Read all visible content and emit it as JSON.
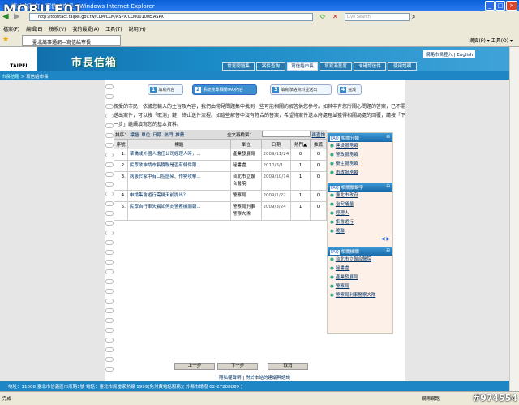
{
  "browser": {
    "title": "臺北市政府 - 寫信給市長 - Windows Internet Explorer",
    "url": "http://tcontact.taipei.gov.tw/CLM/CLM/ASPX/CLM00100E.ASPX",
    "search_placeholder": "Live Search",
    "menu": [
      "檔案(F)",
      "編輯(E)",
      "檢視(V)",
      "我的最愛(A)",
      "工具(T)",
      "說明(H)"
    ],
    "tab": "臺北萬事通網—寫信給市長",
    "tools": "網頁(P) ▾  工具(O) ▾",
    "status_left": "完成",
    "status_zone": "網際網路"
  },
  "watermark": {
    "brand": "MOBILE01",
    "id": "#974554"
  },
  "site": {
    "logo": "TAIPEI",
    "title": "市長信箱",
    "nav": [
      "常見問題集",
      "案件查詢",
      "寫信給市長",
      "填寫滿意度",
      "未確認信件",
      "使用說明"
    ],
    "active_nav": 2,
    "login": "網路市民登入",
    "english": "English",
    "breadcrumb_home": "市長信箱",
    "breadcrumb_current": "寫信給市長"
  },
  "steps": [
    {
      "num": "1",
      "label": "填寫內容"
    },
    {
      "num": "2",
      "label": "系統搜尋相關FAQ內容"
    },
    {
      "num": "3",
      "label": "填寫聯絡資料並送出"
    },
    {
      "num": "4",
      "label": "完成"
    }
  ],
  "intro": "親愛的市民，依據您輸入的主旨及內容，我們由常見問題集中找到一些可能相關的解答供您參考。如其中有您所關心問題的答案，已不需送出案件，可以按「取消」鍵，終止送件流程。如這些解答中沒有符合的答案，希望將案件送本府處理並獲得相關局處的回覆，請按「下一步」繼續填寫您的基本資料。",
  "sort": {
    "label": "排序：",
    "options": [
      "標題",
      "單位",
      "日期",
      "熱門",
      "推薦"
    ],
    "search_label": "全文再檢索：",
    "search_value": "",
    "advanced": "再查詢"
  },
  "table": {
    "headers": [
      "序號",
      "標題",
      "單位",
      "日期",
      "熱門▲",
      "推薦"
    ],
    "rows": [
      [
        "1.",
        "華僑或外國人擔任公司經理人時，...",
        "產業發展局",
        "2009/11/24",
        "0",
        "0"
      ],
      [
        "2.",
        "民眾欲申請市長輓聯是否有條件限...",
        "秘書處",
        "2010/3/1",
        "1",
        "0"
      ],
      [
        "3.",
        "病患於家中有口腔感染、作勢攻擊...",
        "台北市立聯合醫院",
        "2009/10/14",
        "1",
        "0"
      ],
      [
        "4.",
        "申請集會遊行需幾天前提出？",
        "警察局",
        "2009/1/22",
        "1",
        "0"
      ],
      [
        "5.",
        "民眾自行車失竊如何向警察機關報...",
        "警察局刑事警察大隊",
        "2009/3/24",
        "1",
        "0"
      ]
    ]
  },
  "side": [
    {
      "title": "相關分類",
      "items": [
        "建設服務類",
        "警政服務類",
        "衛生服務類",
        "市政服務類"
      ]
    },
    {
      "title": "相關關鍵字",
      "items": [
        "臺北市政府",
        "治安議題",
        "經理人",
        "集會遊行",
        "輓聯"
      ]
    },
    {
      "title": "相關機關",
      "items": [
        "台北市立聯合醫院",
        "秘書處",
        "產業發展局",
        "警察局",
        "警察局刑事警察大隊"
      ]
    }
  ],
  "buttons": {
    "prev": "上一步",
    "next": "下一步",
    "cancel": "取消"
  },
  "footer": {
    "privacy": "隱私權聲明",
    "feedback": "對於本站的建議與諮詢",
    "address": "地址：11008 臺北市信義區市府路1號 電話：臺北市民當家熱線 1999(免付費電話服務)( 外縣市請撥 02-27208889 )"
  }
}
